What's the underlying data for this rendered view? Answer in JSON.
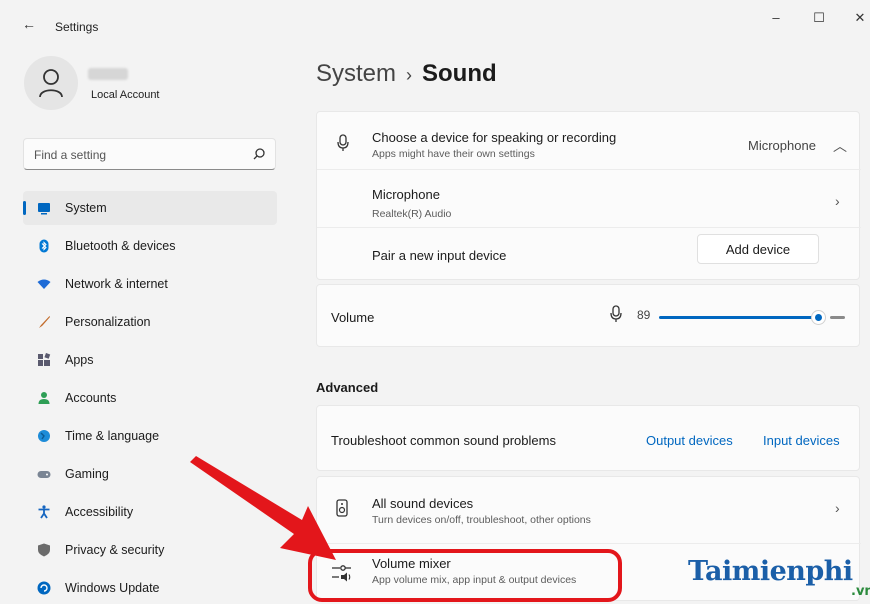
{
  "window": {
    "back_glyph": "←",
    "title": "Settings",
    "min_glyph": "–",
    "max_glyph": "☐",
    "close_glyph": "✕"
  },
  "account": {
    "type": "Local Account"
  },
  "search": {
    "placeholder": "Find a setting",
    "icon": "search-icon"
  },
  "nav": [
    {
      "label": "System",
      "icon": "system-icon",
      "color": "#0067c0",
      "selected": true
    },
    {
      "label": "Bluetooth & devices",
      "icon": "bluetooth-icon",
      "color": "#0078d4"
    },
    {
      "label": "Network & internet",
      "icon": "wifi-icon",
      "color": "#1e6bd6"
    },
    {
      "label": "Personalization",
      "icon": "brush-icon",
      "color": "#c26b2a"
    },
    {
      "label": "Apps",
      "icon": "apps-icon",
      "color": "#5a5a6e"
    },
    {
      "label": "Accounts",
      "icon": "person-icon",
      "color": "#2e9e55"
    },
    {
      "label": "Time & language",
      "icon": "globe-clock-icon",
      "color": "#1d8cd8"
    },
    {
      "label": "Gaming",
      "icon": "gamepad-icon",
      "color": "#7a8594"
    },
    {
      "label": "Accessibility",
      "icon": "accessibility-icon",
      "color": "#1565c0"
    },
    {
      "label": "Privacy & security",
      "icon": "shield-icon",
      "color": "#6b6b6b"
    },
    {
      "label": "Windows Update",
      "icon": "update-icon",
      "color": "#0067c0"
    }
  ],
  "breadcrumb": {
    "parent": "System",
    "separator": "›",
    "current": "Sound"
  },
  "input": {
    "header_title": "Choose a device for speaking or recording",
    "header_sub": "Apps might have their own settings",
    "header_value": "Microphone",
    "device_title": "Microphone",
    "device_sub": "Realtek(R) Audio",
    "pair_label": "Pair a new input device",
    "add_button": "Add device"
  },
  "volume": {
    "label": "Volume",
    "value": "89",
    "level": 0.89
  },
  "advanced": {
    "section_label": "Advanced",
    "troubleshoot_label": "Troubleshoot common sound problems",
    "output_link": "Output devices",
    "input_link": "Input devices",
    "all_devices_title": "All sound devices",
    "all_devices_sub": "Turn devices on/off, troubleshoot, other options",
    "mixer_title": "Volume mixer",
    "mixer_sub": "App volume mix, app input & output devices"
  },
  "watermark": {
    "text": "Taimienphi",
    "sub": ".vn"
  },
  "colors": {
    "accent": "#0067c0",
    "highlight": "#e3161b"
  }
}
